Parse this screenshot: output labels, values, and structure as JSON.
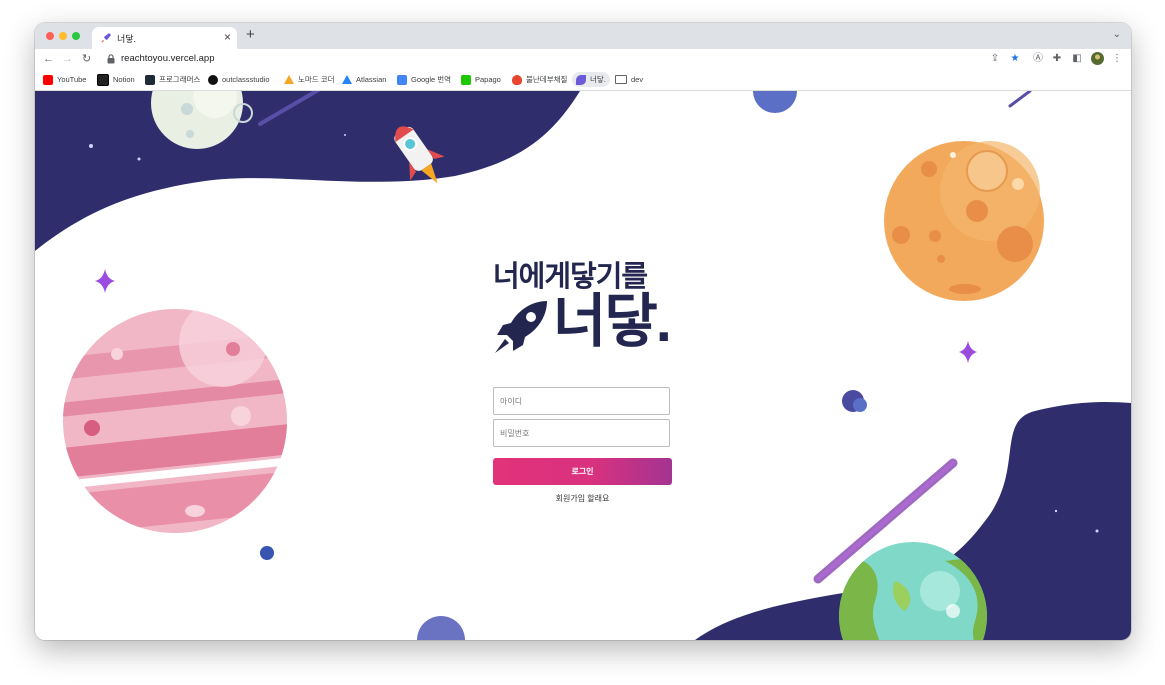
{
  "browser": {
    "tab_title": "너닿.",
    "new_tab_symbol": "+",
    "close_symbol": "×",
    "url": "reachtoyou.vercel.app",
    "bookmarks": [
      {
        "label": "YouTube",
        "color": "#ff0000"
      },
      {
        "label": "Notion",
        "color": "#222222"
      },
      {
        "label": "프로그래머스",
        "color": "#1e2a38"
      },
      {
        "label": "outclassstudio",
        "color": "#111111"
      },
      {
        "label": "노마드 코더",
        "color": "#f5a623"
      },
      {
        "label": "Atlassian",
        "color": "#2684ff"
      },
      {
        "label": "Google 번역",
        "color": "#4285f4"
      },
      {
        "label": "Papago",
        "color": "#1ec800"
      },
      {
        "label": "불난데부채질",
        "color": "#e8462e"
      },
      {
        "label": "너닿.",
        "color": "#6b5bd6"
      },
      {
        "label": "dev",
        "color": "#5f6368"
      }
    ]
  },
  "login": {
    "slogan": "너에게닿기를",
    "logo_text": "너닿.",
    "id_placeholder": "아이디",
    "password_placeholder": "비밀번호",
    "login_button": "로그인",
    "signup_link": "회원가입 할래요"
  },
  "colors": {
    "navy": "#2f2d6b",
    "brand_text": "#23264f",
    "button_start": "#e2327a",
    "button_end": "#a43391"
  }
}
